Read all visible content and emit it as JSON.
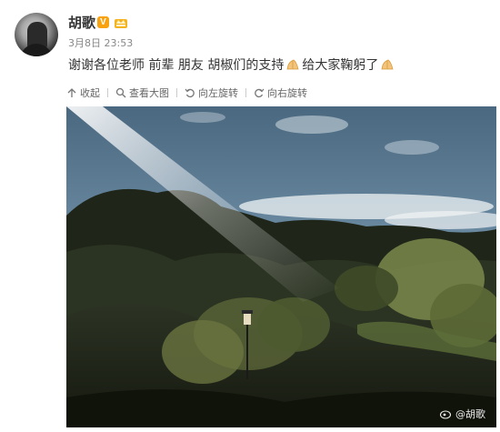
{
  "post": {
    "username": "胡歌",
    "vip_badge": "V",
    "timestamp": "3月8日 23:53",
    "text_part1": "谢谢各位老师 前辈 朋友 胡椒们的支持",
    "text_part2": "给大家鞠躬了",
    "emoji_icon": "bow-hands-emoji"
  },
  "actions": [
    {
      "icon": "collapse-arrow-icon",
      "label": "收起"
    },
    {
      "icon": "magnify-icon",
      "label": "查看大图"
    },
    {
      "icon": "rotate-left-icon",
      "label": "向左旋转"
    },
    {
      "icon": "rotate-right-icon",
      "label": "向右旋转"
    }
  ],
  "watermark": {
    "text": "@胡歌"
  },
  "colors": {
    "text": "#333333",
    "muted": "#888888",
    "badge": "#f7a20e"
  }
}
